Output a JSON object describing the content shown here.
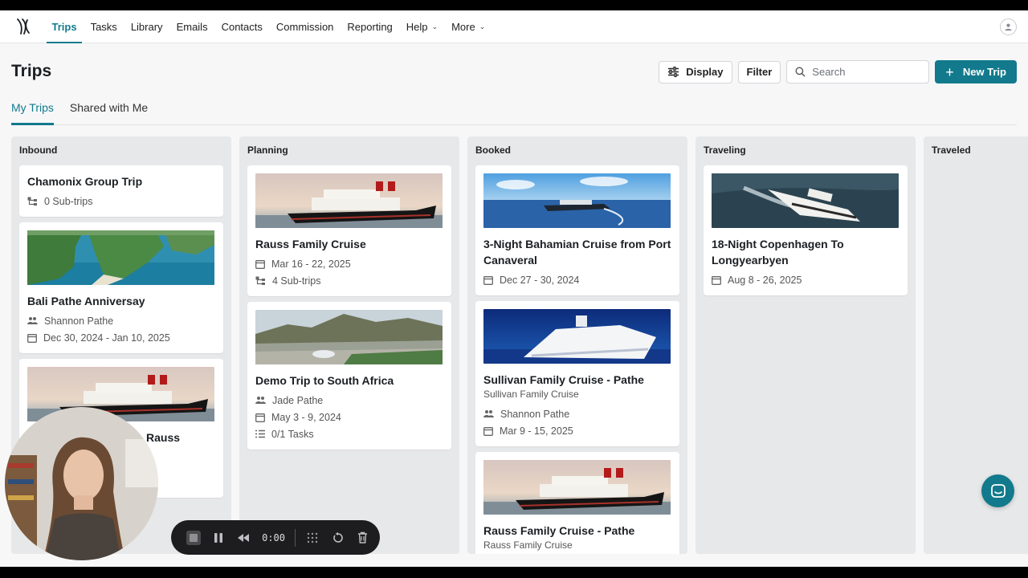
{
  "nav": {
    "items": [
      {
        "label": "Trips",
        "active": true
      },
      {
        "label": "Tasks"
      },
      {
        "label": "Library"
      },
      {
        "label": "Emails"
      },
      {
        "label": "Contacts"
      },
      {
        "label": "Commission"
      },
      {
        "label": "Reporting"
      },
      {
        "label": "Help",
        "dropdown": true
      },
      {
        "label": "More",
        "dropdown": true
      }
    ]
  },
  "page": {
    "title": "Trips"
  },
  "toolbar": {
    "display_label": "Display",
    "filter_label": "Filter",
    "search_placeholder": "Search",
    "new_trip_label": "New Trip"
  },
  "tabs": [
    {
      "label": "My Trips",
      "active": true
    },
    {
      "label": "Shared with Me"
    }
  ],
  "columns": [
    {
      "title": "Inbound",
      "cards": [
        {
          "title": "Chamonix Group Trip",
          "subtrips": "0 Sub-trips"
        },
        {
          "image": "beach-cliff",
          "title": "Bali Pathe Anniversay",
          "people": "Shannon Pathe",
          "dates": "Dec 30, 2024 - Jan 10, 2025"
        },
        {
          "image": "ship-sunset",
          "title": "Rauss"
        }
      ]
    },
    {
      "title": "Planning",
      "cards": [
        {
          "image": "ship-sunset",
          "title": "Rauss Family Cruise",
          "dates": "Mar 16 - 22, 2025",
          "subtrips": "4 Sub-trips"
        },
        {
          "image": "city-mountain",
          "title": "Demo Trip to South Africa",
          "people": "Jade Pathe",
          "dates": "May 3 - 9, 2024",
          "tasks": "0/1 Tasks"
        }
      ]
    },
    {
      "title": "Booked",
      "cards": [
        {
          "image": "ship-ocean",
          "title": "3-Night Bahamian Cruise from Port Canaveral",
          "dates": "Dec 27 - 30, 2024"
        },
        {
          "image": "ship-white",
          "title": "Sullivan Family Cruise - Pathe",
          "subtitle": "Sullivan Family Cruise",
          "people": "Shannon Pathe",
          "dates": "Mar 9 - 15, 2025"
        },
        {
          "image": "ship-sunset",
          "title": "Rauss Family Cruise - Pathe",
          "subtitle": "Rauss Family Cruise"
        }
      ]
    },
    {
      "title": "Traveling",
      "cards": [
        {
          "image": "ship-wake",
          "title": "18-Night Copenhagen To Longyearbyen",
          "dates": "Aug 8 - 26, 2025"
        }
      ]
    },
    {
      "title": "Traveled",
      "cards": []
    }
  ],
  "recorder": {
    "time": "0:00"
  },
  "colors": {
    "accent": "#127a8c",
    "column_bg": "#e7e8ea"
  }
}
